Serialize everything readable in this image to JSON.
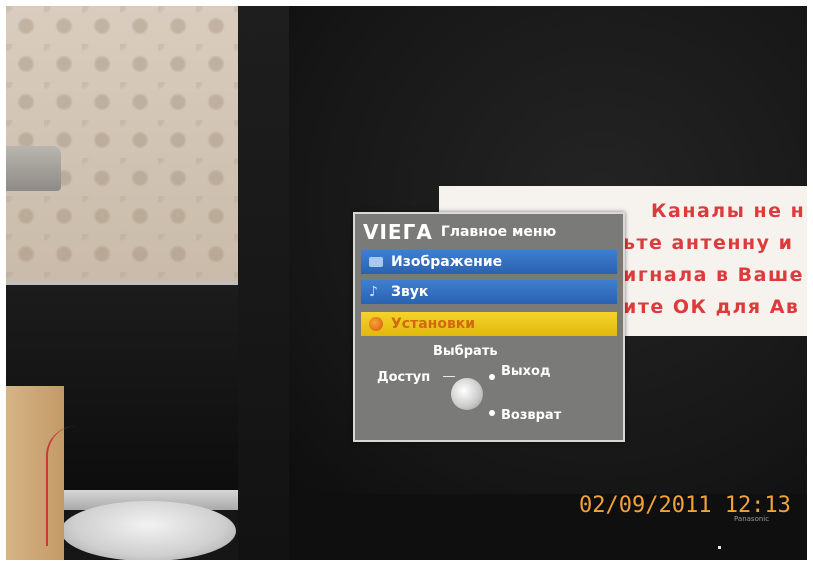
{
  "menu": {
    "logo": "VIEГA",
    "title": "Главное меню",
    "items": [
      {
        "label": "Изображение",
        "icon": "picture-icon",
        "state": "normal",
        "color": "#2f6cc0"
      },
      {
        "label": "Звук",
        "icon": "music-note-icon",
        "state": "normal",
        "color": "#2f6cc0"
      },
      {
        "label": "Установки",
        "icon": "setup-icon",
        "state": "selected",
        "color": "#f0cc1e"
      }
    ],
    "nav": {
      "select": "Выбрать",
      "access": "Доступ",
      "exit": "Выход",
      "return": "Возврат"
    }
  },
  "warning": {
    "lines": [
      "Каналы не н",
      "ьте антенну и",
      "игнала в Ваше",
      "ите ОК для Ав"
    ],
    "color": "#dd3b3b"
  },
  "timestamp": "02/09/2011  12:13",
  "brand": "Panasonic"
}
